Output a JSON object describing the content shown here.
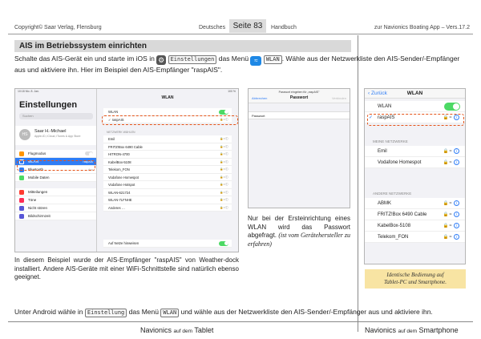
{
  "header": {
    "copyright": "Copyright© Saar Verlag, Flensburg",
    "section": "Deutsches",
    "page": "Seite 83",
    "section_after": "Handbuch",
    "app": "zur Navionics Boating App – Vers.17.2"
  },
  "section_title": "AIS im Betriebssystem einrichten",
  "intro": {
    "part1": "Schalte das AIS-Gerät ein und starte im iOS in",
    "settings_key": "Einstellungen",
    "part2": "das Menü",
    "wlan_key": "WLAN",
    "part3": ". Wähle aus der Netzwerkliste den AIS-Sender/-Empfänger aus und aktiviere ihn. Hier im Beispiel den AIS-Empfänger \"raspAIS\"."
  },
  "tablet": {
    "status_left": "10:18 Mo. 8. Jan.",
    "status_right": "100 %",
    "title": "Einstellungen",
    "search_placeholder": "Suchen",
    "profile": {
      "initials": "HS",
      "name": "Saar H.-Michael",
      "subtitle": "Apple-ID, iCloud, iTunes & App Store"
    },
    "menu1": [
      {
        "label": "Flugmodus",
        "value": "",
        "color": "#ff9500"
      },
      {
        "label": "WLAN",
        "value": "raspAIS",
        "color": "#2f7df6"
      },
      {
        "label": "Bluetooth",
        "value": "Aus",
        "color": "#2f7df6"
      },
      {
        "label": "Mobile Daten",
        "value": "",
        "color": "#4cd964"
      }
    ],
    "menu2": [
      {
        "label": "Mitteilungen",
        "color": "#ff3b30"
      },
      {
        "label": "Töne",
        "color": "#ff2d55"
      },
      {
        "label": "Nicht stören",
        "color": "#5856d6"
      },
      {
        "label": "Bildschirmzeit",
        "color": "#5856d6"
      }
    ],
    "wlan_title": "WLAN",
    "wlan_label": "WLAN",
    "connected": "raspAIS",
    "networks_header": "NETZWERK WÄHLEN",
    "networks": [
      "Emil",
      "FRITZ!Box 6490 Cable",
      "HITRON-4700",
      "KabelBox-5108",
      "Telekom_FON",
      "Vodafone Homespot",
      "Vodafone Hotspot",
      "WLAN-621724",
      "WLAN-7LFNHE",
      "Anderes …"
    ],
    "ask_join": "Auf Netze hinweisen"
  },
  "tablet_desc": "In diesem Beispiel wurde der AIS-Empfänger \"raspAIS\" von Weather-dock installiert. Andere AIS-Geräte mit einer WiFi-Schnittstelle sind natürlich ebenso geeignet.",
  "password_dialog": {
    "caption": "Passwort eingeben für „raspAIS\"",
    "title": "Passwort",
    "cancel": "Abbrechen",
    "join": "Verbinden",
    "field_label": "Passwort"
  },
  "password_desc": "Nur bei der Ersteinrichtung eines WLAN wird das Passwort abgefragt.",
  "password_note": "(ist vom Gerätehersteller zu erfahren)",
  "phone": {
    "back": "Zurück",
    "title": "WLAN",
    "wlan_label": "WLAN",
    "connected": "raspAIS",
    "my_header": "MEINE NETZWERKE",
    "my_networks": [
      "Emil",
      "Vodafone Homespot"
    ],
    "other_header": "ANDERE NETZWERKE",
    "other_networks": [
      "ABMK",
      "FRITZ!Box 6490 Cable",
      "KabelBox-5108",
      "Telekom_FON"
    ]
  },
  "note": {
    "line1": "Identische Bedienung auf",
    "line2": "Tablet-PC und Smartphone."
  },
  "android": {
    "part1": "Unter Android wähle in",
    "settings_key": "Einstellung",
    "part2": "das Menü",
    "wlan_key": "WLAN",
    "part3": "und wähle aus der Netzwerkliste den AIS-Sender/-Empfänger aus und aktiviere ihn."
  },
  "footer": {
    "left_brand": "Navionics",
    "left_mid": "auf dem",
    "left_device": "Tablet",
    "right_brand": "Navionics",
    "right_mid": "auf dem",
    "right_device": "Smartphone"
  },
  "accent": {
    "highlight": "#e5551a",
    "ios_blue": "#2f7df6",
    "toggle_green": "#4cd964",
    "note_bg": "#f8e4a3"
  }
}
